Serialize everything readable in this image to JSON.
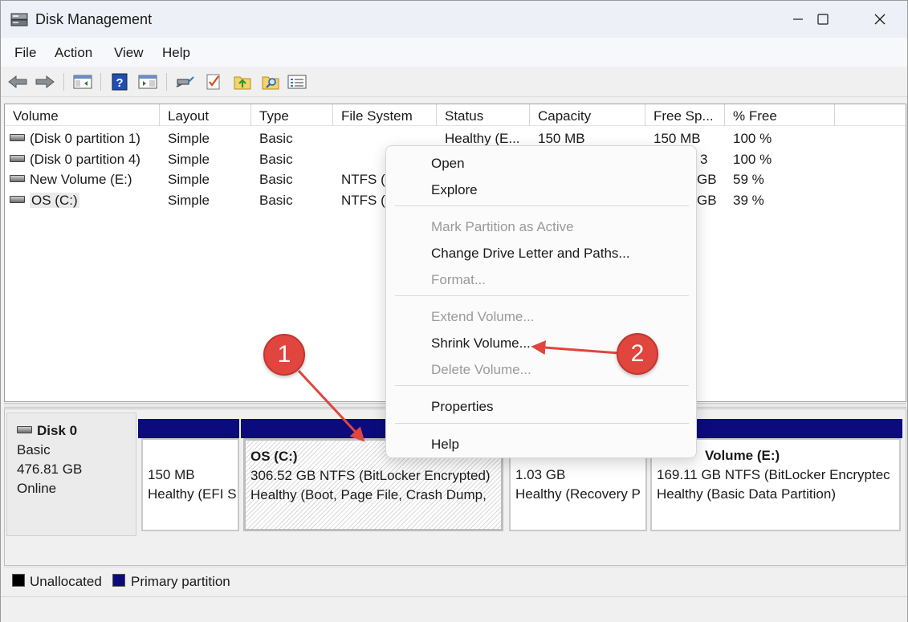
{
  "window": {
    "title": "Disk Management",
    "controls": {
      "minimize": "minimize-icon",
      "maximize": "maximize-icon",
      "close": "close-icon"
    }
  },
  "menubar": [
    "File",
    "Action",
    "View",
    "Help"
  ],
  "toolbar": [
    "back-icon",
    "forward-icon",
    "show-hide-console-tree-icon",
    "help-icon",
    "show-action-pane-icon",
    "connect-icon",
    "checkmark-icon",
    "folder-up-icon",
    "folder-search-icon",
    "properties-list-icon"
  ],
  "volume_list": {
    "columns": [
      "Volume",
      "Layout",
      "Type",
      "File System",
      "Status",
      "Capacity",
      "Free Sp...",
      "% Free"
    ],
    "rows": [
      {
        "volume": "(Disk 0 partition 1)",
        "layout": "Simple",
        "type": "Basic",
        "fs": "",
        "status": "Healthy (E...",
        "capacity": "150 MB",
        "free": "150 MB",
        "pct": "100 %"
      },
      {
        "volume": "(Disk 0 partition 4)",
        "layout": "Simple",
        "type": "Basic",
        "fs": "",
        "status": "",
        "capacity": "",
        "free": "3",
        "pct": "100 %"
      },
      {
        "volume": "New Volume (E:)",
        "layout": "Simple",
        "type": "Basic",
        "fs": "NTFS (",
        "status": "",
        "capacity": "",
        "free": "GB",
        "pct": "59 %"
      },
      {
        "volume": "OS (C:)",
        "layout": "Simple",
        "type": "Basic",
        "fs": "NTFS (",
        "status": "",
        "capacity": "",
        "free": "GB",
        "pct": "39 %"
      }
    ]
  },
  "disk": {
    "name": "Disk 0",
    "type": "Basic",
    "size": "476.81 GB",
    "state": "Online",
    "partitions": [
      {
        "title": "",
        "line1": "150 MB",
        "line2": "Healthy (EFI S"
      },
      {
        "title": "OS  (C:)",
        "line1": "306.52 GB NTFS (BitLocker Encrypted)",
        "line2": "Healthy (Boot, Page File, Crash Dump,"
      },
      {
        "title": "",
        "line1": "1.03 GB",
        "line2": "Healthy (Recovery P"
      },
      {
        "title": "Volume  (E:)",
        "line1": "169.11 GB NTFS (BitLocker Encryptec",
        "line2": "Healthy (Basic Data Partition)"
      }
    ]
  },
  "legend": [
    {
      "label": "Unallocated",
      "color": "#000000"
    },
    {
      "label": "Primary partition",
      "color": "#0b0b7d"
    }
  ],
  "context_menu": {
    "items": [
      {
        "label": "Open",
        "enabled": true
      },
      {
        "label": "Explore",
        "enabled": true
      },
      {
        "label": "Mark Partition as Active",
        "enabled": false
      },
      {
        "label": "Change Drive Letter and Paths...",
        "enabled": true
      },
      {
        "label": "Format...",
        "enabled": false
      },
      {
        "label": "Extend Volume...",
        "enabled": false
      },
      {
        "label": "Shrink Volume...",
        "enabled": true
      },
      {
        "label": "Delete Volume...",
        "enabled": false
      },
      {
        "label": "Properties",
        "enabled": true
      },
      {
        "label": "Help",
        "enabled": true
      }
    ]
  },
  "callouts": [
    "1",
    "2"
  ],
  "colors": {
    "callout": "#e0453e",
    "primary_partition": "#0b0b7d",
    "arrow": "#e0453e"
  }
}
